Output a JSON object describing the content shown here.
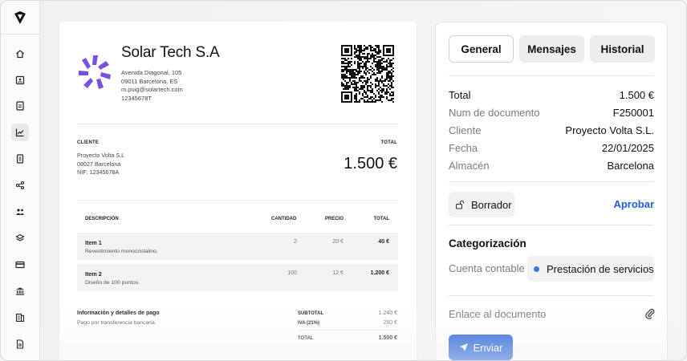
{
  "sidebar": {
    "logo_icon": "diamond-logo-icon",
    "items": [
      {
        "name": "home",
        "icon": "home-icon"
      },
      {
        "name": "contacts",
        "icon": "contact-card-icon"
      },
      {
        "name": "invoices",
        "icon": "document-dollar-icon"
      },
      {
        "name": "analytics",
        "icon": "chart-line-icon",
        "active": true
      },
      {
        "name": "reports",
        "icon": "report-icon"
      },
      {
        "name": "integrations",
        "icon": "share-nodes-icon"
      },
      {
        "name": "team",
        "icon": "users-icon"
      },
      {
        "name": "inventory",
        "icon": "layers-icon"
      },
      {
        "name": "payments",
        "icon": "card-icon"
      },
      {
        "name": "banking",
        "icon": "bank-icon"
      },
      {
        "name": "accounting",
        "icon": "ledger-icon"
      },
      {
        "name": "documents",
        "icon": "file-icon"
      }
    ]
  },
  "invoice": {
    "company_name": "Solar Tech S.A",
    "company_address_1": "Avenida Diagonal, 105",
    "company_address_2": "09011 Barcelona, ES",
    "company_email": "m.puig@solartech.com",
    "company_tax_id": "12345678T",
    "client_label": "CLIENTE",
    "client_name": "Proyecto Volta S.L",
    "client_city": "08027 Barcelona",
    "client_nif": "NIF: 12345678A",
    "total_label": "TOTAL",
    "total_amount": "1.500 €",
    "columns": {
      "description": "DESCRIPCIÓN",
      "quantity": "CANTIDAD",
      "price": "PRECIO",
      "total": "TOTAL"
    },
    "items": [
      {
        "name": "Item 1",
        "description": "Revestimiento monocristalino.",
        "quantity": "2",
        "price": "20 €",
        "total": "40 €"
      },
      {
        "name": "Item 2",
        "description": "Diseño de 100 puntos.",
        "quantity": "100",
        "price": "12 €",
        "total": "1.200 €"
      }
    ],
    "payment_title": "Información y detalles de pago",
    "payment_description": "Pago por transferencia bancaria.",
    "summary": {
      "subtotal_label": "SUBTOTAL",
      "subtotal_value": "1.240 €",
      "tax_label": "IVA (21%)",
      "tax_value": "260 €",
      "total_label": "TOTAL",
      "total_value": "1.500 €"
    },
    "brand_color": "#7b4fe0"
  },
  "panel": {
    "tabs": [
      {
        "label": "General",
        "active": true
      },
      {
        "label": "Mensajes",
        "active": false
      },
      {
        "label": "Historial",
        "active": false
      }
    ],
    "details": [
      {
        "label": "Total",
        "value": "1.500 €"
      },
      {
        "label": "Num de documento",
        "value": "F250001"
      },
      {
        "label": "Cliente",
        "value": "Proyecto Volta S.L."
      },
      {
        "label": "Fecha",
        "value": "22/01/2025"
      },
      {
        "label": "Almacén",
        "value": "Barcelona"
      }
    ],
    "status_label": "Borrador",
    "status_icon": "unlock-icon",
    "approve_label": "Aprobar",
    "categorization_title": "Categorización",
    "account_label": "Cuenta contable",
    "account_value": "Prestación de servicios",
    "document_link_label": "Enlace al documento",
    "send_label": "Enviar",
    "accent_color": "#1f5fd6"
  }
}
